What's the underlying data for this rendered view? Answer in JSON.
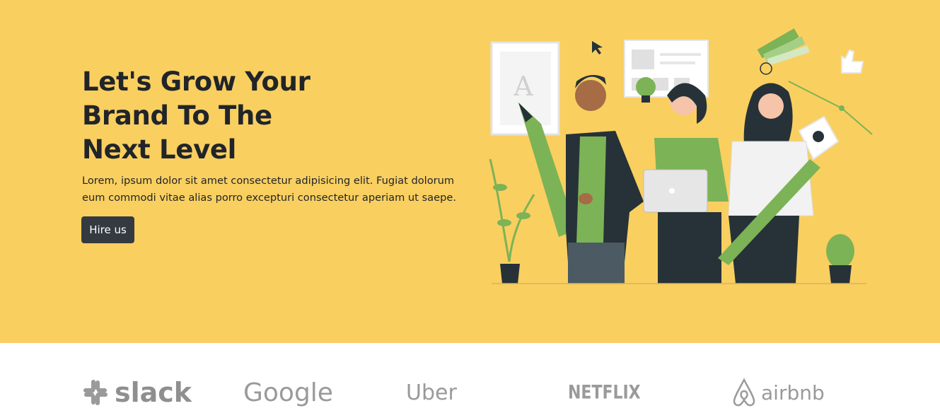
{
  "hero": {
    "title_lines": [
      "Let's Grow Your",
      "Brand To The",
      "Next Level"
    ],
    "description": "Lorem, ipsum dolor sit amet consectetur adipisicing elit. Fugiat dolorum eum commodi vitae alias porro excepturi consectetur aperiam ut saepe.",
    "cta_label": "Hire us",
    "background_color": "#f9cf60",
    "button_color": "#343a40",
    "illustration_letter": "A"
  },
  "logos": [
    {
      "name": "slack",
      "icon": "slack-logo-icon"
    },
    {
      "name": "Google",
      "icon": "google-wordmark"
    },
    {
      "name": "Uber",
      "icon": "uber-wordmark"
    },
    {
      "name": "NETFLIX",
      "icon": "netflix-wordmark"
    },
    {
      "name": "airbnb",
      "icon": "airbnb-logo-icon"
    }
  ],
  "colors": {
    "accent_green": "#7cb356",
    "dark": "#263238",
    "logo_gray": "#8c8c8c"
  }
}
